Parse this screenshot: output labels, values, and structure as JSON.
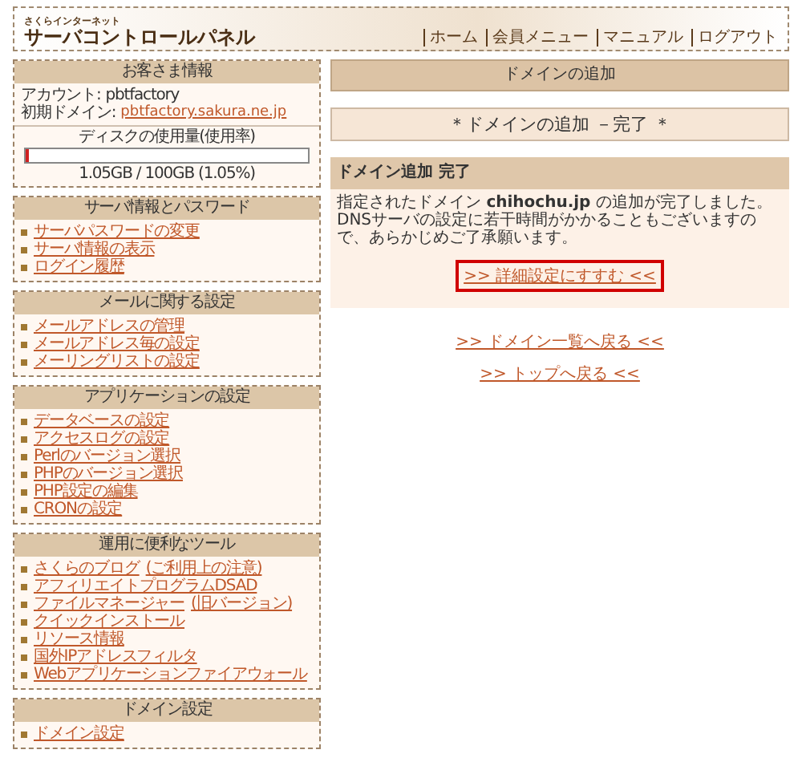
{
  "header": {
    "brand_small": "さくらインターネット",
    "brand": "サーバコントロールパネル",
    "nav": [
      "ホーム",
      "会員メニュー",
      "マニュアル",
      "ログアウト"
    ]
  },
  "sidebar": {
    "account": {
      "title": "お客さま情報",
      "rows": [
        {
          "label": "アカウント:",
          "value": "pbtfactory",
          "kind": "text"
        },
        {
          "label": "初期ドメイン:",
          "value": "pbtfactory.sakura.ne.jp",
          "kind": "link"
        }
      ],
      "disk": {
        "label": "ディスクの使用量(使用率)",
        "level": 0.0105,
        "reading": "1.05GB / 100GB (1.05%)"
      }
    },
    "sections": [
      {
        "title": "サーバ情報とパスワード",
        "items": [
          {
            "label": "サーバパスワードの変更"
          },
          {
            "label": "サーバ情報の表示"
          },
          {
            "label": "ログイン履歴"
          }
        ]
      },
      {
        "title": "メールに関する設定",
        "items": [
          {
            "label": "メールアドレスの管理"
          },
          {
            "label": "メールアドレス毎の設定"
          },
          {
            "label": "メーリングリストの設定"
          }
        ]
      },
      {
        "title": "アプリケーションの設定",
        "items": [
          {
            "label": "データベースの設定"
          },
          {
            "label": "アクセスログの設定"
          },
          {
            "label": "Perlのバージョン選択"
          },
          {
            "label": "PHPのバージョン選択"
          },
          {
            "label": "PHP設定の編集"
          },
          {
            "label": "CRONの設定"
          }
        ]
      },
      {
        "title": "運用に便利なツール",
        "items": [
          {
            "label": "さくらのブログ",
            "note": "(ご利用上の注意)"
          },
          {
            "label": "アフィリエイトプログラムDSAD"
          },
          {
            "label": "ファイルマネージャー",
            "note": "(旧バージョン)"
          },
          {
            "label": "クイックインストール"
          },
          {
            "label": "リソース情報"
          },
          {
            "label": "国外IPアドレスフィルタ"
          },
          {
            "label": "Webアプリケーションファイアウォール"
          }
        ]
      },
      {
        "title": "ドメイン設定",
        "items": [
          {
            "label": "ドメイン設定"
          }
        ]
      }
    ]
  },
  "main": {
    "page_title": "ドメインの追加",
    "step_title": "＊ドメインの追加 －完了 ＊",
    "panel": {
      "title": "ドメイン追加 完了",
      "lines": [
        "指定されたドメイン **chihochu.jp** の追加が完了しました。",
        "DNSサーバの設定に若干時間がかかることもございますので、あらかじめご了承願います。"
      ],
      "button": ">> 詳細設定にすすむ <<"
    },
    "links": [
      ">> ドメイン一覧へ戻る <<",
      ">> トップへ戻る <<"
    ]
  }
}
